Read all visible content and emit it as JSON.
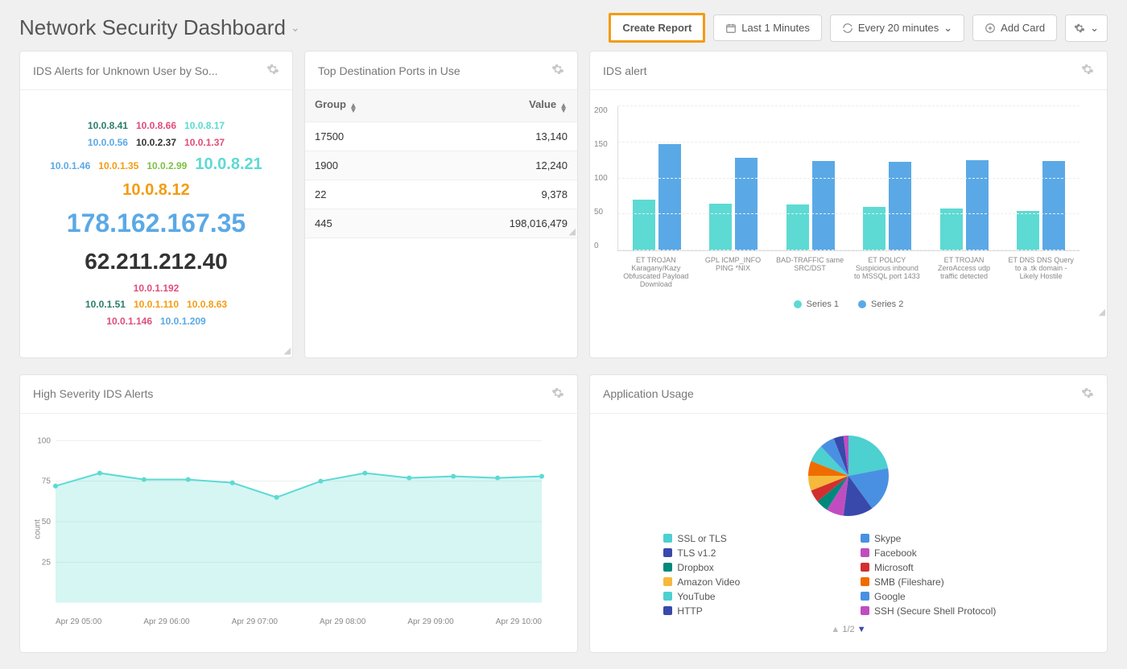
{
  "header": {
    "title": "Network Security Dashboard",
    "create_report": "Create Report",
    "time_range": "Last 1 Minutes",
    "refresh": "Every 20 minutes",
    "add_card": "Add Card"
  },
  "cards": {
    "ids_unknown": {
      "title": "IDS Alerts for Unknown User by So..."
    },
    "top_ports": {
      "title": "Top Destination Ports in Use",
      "col_group": "Group",
      "col_value": "Value"
    },
    "ids_alert": {
      "title": "IDS alert"
    },
    "high_severity": {
      "title": "High Severity IDS Alerts",
      "ylabel": "count"
    },
    "app_usage": {
      "title": "Application Usage",
      "pager": "1/2"
    }
  },
  "ip_cloud": [
    {
      "text": "10.0.8.41",
      "color": "#2e7d6b",
      "size": 12
    },
    {
      "text": "10.0.8.66",
      "color": "#e04d7a",
      "size": 12
    },
    {
      "text": "10.0.8.17",
      "color": "#5ddad3",
      "size": 12
    },
    {
      "text": "10.0.0.56",
      "color": "#5aa9e6",
      "size": 12
    },
    {
      "text": "10.0.2.37",
      "color": "#333333",
      "size": 12
    },
    {
      "text": "10.0.1.37",
      "color": "#e04d7a",
      "size": 12
    },
    {
      "text": "10.0.1.46",
      "color": "#5aa9e6",
      "size": 12
    },
    {
      "text": "10.0.1.35",
      "color": "#f39c12",
      "size": 12
    },
    {
      "text": "10.0.2.99",
      "color": "#7bc043",
      "size": 12
    },
    {
      "text": "10.0.8.21",
      "color": "#5ddad3",
      "size": 20
    },
    {
      "text": "10.0.8.12",
      "color": "#f39c12",
      "size": 20
    },
    {
      "text": "178.162.167.35",
      "color": "#5aa9e6",
      "size": 32
    },
    {
      "text": "62.211.212.40",
      "color": "#333333",
      "size": 28
    },
    {
      "text": "10.0.1.192",
      "color": "#e04d7a",
      "size": 12
    },
    {
      "text": "10.0.1.51",
      "color": "#2e7d6b",
      "size": 12
    },
    {
      "text": "10.0.1.110",
      "color": "#f39c12",
      "size": 12
    },
    {
      "text": "10.0.8.63",
      "color": "#f39c12",
      "size": 12
    },
    {
      "text": "10.0.1.146",
      "color": "#e04d7a",
      "size": 12
    },
    {
      "text": "10.0.1.209",
      "color": "#5aa9e6",
      "size": 12
    }
  ],
  "ports_table": [
    {
      "group": "17500",
      "value": "13,140"
    },
    {
      "group": "1900",
      "value": "12,240"
    },
    {
      "group": "22",
      "value": "9,378"
    },
    {
      "group": "445",
      "value": "198,016,479"
    }
  ],
  "chart_data": [
    {
      "id": "ids_alert",
      "type": "bar",
      "categories": [
        "ET TROJAN Karagany/Kazy Obfuscated Payload Download",
        "GPL ICMP_INFO PING *NIX",
        "BAD-TRAFFIC same SRC/DST",
        "ET POLICY Suspicious inbound to MSSQL port 1433",
        "ET TROJAN ZeroAccess udp traffic detected",
        "ET DNS DNS Query to a .tk domain - Likely Hostile"
      ],
      "series": [
        {
          "name": "Series 1",
          "values": [
            70,
            65,
            63,
            60,
            58,
            55
          ],
          "color": "#5ddad3"
        },
        {
          "name": "Series 2",
          "values": [
            147,
            128,
            123,
            122,
            125,
            123
          ],
          "color": "#5aa9e6"
        }
      ],
      "ylim": [
        0,
        200
      ],
      "yticks": [
        0,
        50,
        100,
        150,
        200
      ]
    },
    {
      "id": "high_severity",
      "type": "area",
      "x": [
        "Apr 29 05:00",
        "Apr 29 06:00",
        "Apr 29 07:00",
        "Apr 29 08:00",
        "Apr 29 09:00",
        "Apr 29 10:00"
      ],
      "values": [
        72,
        80,
        76,
        76,
        74,
        65,
        75,
        80,
        77,
        78,
        77,
        78
      ],
      "ylabel": "count",
      "ylim": [
        0,
        100
      ],
      "yticks": [
        25,
        50,
        75,
        100
      ],
      "color": "#5ddad3"
    },
    {
      "id": "app_usage",
      "type": "pie",
      "slices": [
        {
          "label": "SSL or TLS",
          "value": 22,
          "color": "#4dd0d0"
        },
        {
          "label": "Skype",
          "value": 18,
          "color": "#4a90e2"
        },
        {
          "label": "TLS v1.2",
          "value": 12,
          "color": "#3949ab"
        },
        {
          "label": "Facebook",
          "value": 7,
          "color": "#c04dc0"
        },
        {
          "label": "Dropbox",
          "value": 5,
          "color": "#00897b"
        },
        {
          "label": "Microsoft",
          "value": 5,
          "color": "#d32f2f"
        },
        {
          "label": "Amazon Video",
          "value": 6,
          "color": "#f6b93b"
        },
        {
          "label": "SMB (Fileshare)",
          "value": 6,
          "color": "#ef6c00"
        },
        {
          "label": "YouTube",
          "value": 7,
          "color": "#4dd0d0"
        },
        {
          "label": "Google",
          "value": 6,
          "color": "#4a90e2"
        },
        {
          "label": "HTTP",
          "value": 4,
          "color": "#3949ab"
        },
        {
          "label": "SSH (Secure Shell Protocol)",
          "value": 2,
          "color": "#c04dc0"
        }
      ]
    }
  ]
}
